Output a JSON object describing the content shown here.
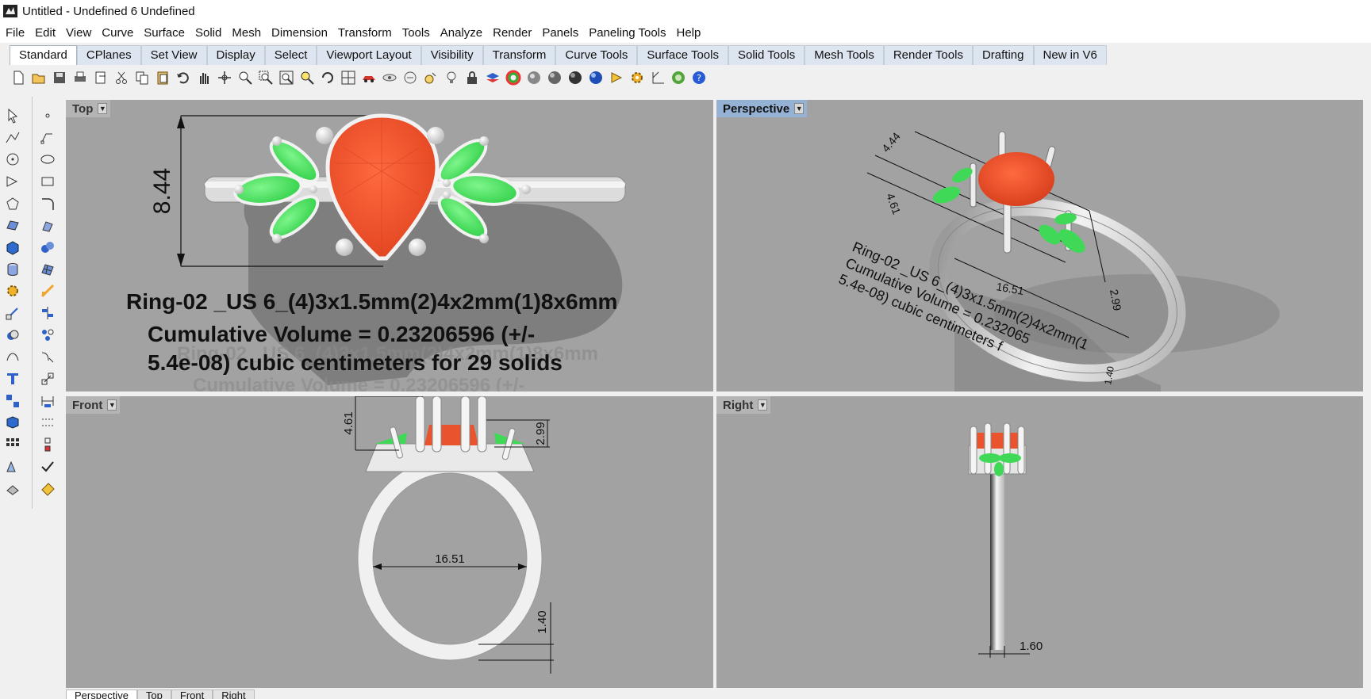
{
  "window": {
    "title": "Untitled - Undefined 6 Undefined"
  },
  "menu": [
    "File",
    "Edit",
    "View",
    "Curve",
    "Surface",
    "Solid",
    "Mesh",
    "Dimension",
    "Transform",
    "Tools",
    "Analyze",
    "Render",
    "Panels",
    "Paneling Tools",
    "Help"
  ],
  "toolbar_tabs": [
    "Standard",
    "CPlanes",
    "Set View",
    "Display",
    "Select",
    "Viewport Layout",
    "Visibility",
    "Transform",
    "Curve Tools",
    "Surface Tools",
    "Solid Tools",
    "Mesh Tools",
    "Render Tools",
    "Drafting",
    "New in V6"
  ],
  "active_toolbar_tab": "Standard",
  "toolbar_icons": [
    "new-file-icon",
    "open-icon",
    "save-icon",
    "print-icon",
    "import-icon",
    "cut-icon",
    "copy-icon",
    "paste-icon",
    "undo-icon",
    "pan-hand-icon",
    "move-icon",
    "zoom-icon",
    "zoom-window-icon",
    "zoom-extents-icon",
    "zoom-selected-icon",
    "rotate-view-icon",
    "grid-icon",
    "car-icon",
    "hide-icon",
    "show-icon",
    "lock-icon",
    "layer-icon",
    "color-wheel-icon",
    "render-sphere-icon",
    "shaded-sphere-icon",
    "ghost-sphere-icon",
    "blue-sphere-icon",
    "light-icon",
    "options-gear-icon",
    "cplane-icon",
    "circle-green-icon",
    "help-icon"
  ],
  "viewports": {
    "top": {
      "label": "Top",
      "dimension": "8.44",
      "title_line": "Ring-02 _US 6_(4)3x1.5mm(2)4x2mm(1)8x6mm",
      "volume_line1": "Cumulative Volume = 0.23206596 (+/-",
      "volume_line2": "5.4e-08) cubic centimeters for 29 solids"
    },
    "perspective": {
      "label": "Perspective",
      "dim_a": "4.44",
      "dim_b": "4.61",
      "dim_c": "16.51",
      "dim_d": "2.99",
      "dim_e": "1.40",
      "text_line1": "Ring-02 _US 6_(4)3x1.5mm(2)4x2mm(1",
      "text_line2": "Cumulative Volume = 0.232065",
      "text_line3": "5.4e-08) cubic centimeters f"
    },
    "front": {
      "label": "Front",
      "dim_height": "4.61",
      "dim_right": "2.99",
      "dim_inner": "16.51",
      "dim_band": "1.40"
    },
    "right": {
      "label": "Right",
      "dim_width": "1.60"
    }
  },
  "viewport_tabs": [
    "Perspective",
    "Top",
    "Front",
    "Right"
  ],
  "colors": {
    "gem_red": "#f0522d",
    "leaf_green": "#49dd5c",
    "metal": "#e2e2e2",
    "viewport_bg": "#a2a2a2"
  }
}
